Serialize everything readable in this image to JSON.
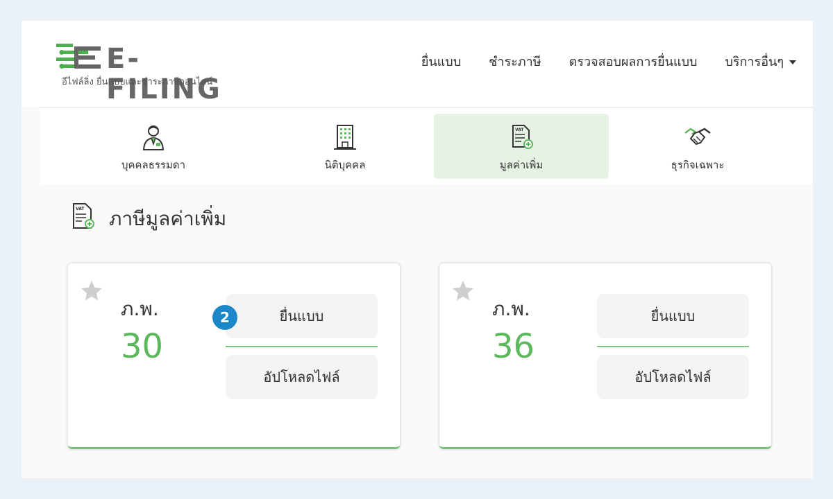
{
  "brand": {
    "name": "E-FILING",
    "tagline": "อีไฟล์ลิ่ง ยื่นแบบและชำระภาษีออนไลน์"
  },
  "nav": {
    "items": [
      {
        "label": "ยื่นแบบ"
      },
      {
        "label": "ชำระภาษี"
      },
      {
        "label": "ตรวจสอบผลการยื่นแบบ"
      },
      {
        "label": "บริการอื่นๆ"
      }
    ]
  },
  "categories": [
    {
      "label": "บุคคลธรรมดา",
      "icon": "person-icon"
    },
    {
      "label": "นิติบุคคล",
      "icon": "building-icon"
    },
    {
      "label": "มูลค่าเพิ่ม",
      "icon": "vat-document-icon",
      "active": true
    },
    {
      "label": "ธุรกิจเฉพาะ",
      "icon": "handshake-icon"
    }
  ],
  "section": {
    "title": "ภาษีมูลค่าเพิ่ม",
    "icon_badge": "VAT"
  },
  "forms": [
    {
      "label": "ภ.พ.",
      "number": "30",
      "file_label": "ยื่นแบบ",
      "upload_label": "อัปโหลดไฟล์"
    },
    {
      "label": "ภ.พ.",
      "number": "36",
      "file_label": "ยื่นแบบ",
      "upload_label": "อัปโหลดไฟล์"
    }
  ],
  "step_marker": "2",
  "colors": {
    "brand_green": "#5cb85c",
    "active_tab_bg": "#e6f2e3",
    "step_badge": "#1b87c9",
    "page_bg": "#e8f2f8"
  }
}
